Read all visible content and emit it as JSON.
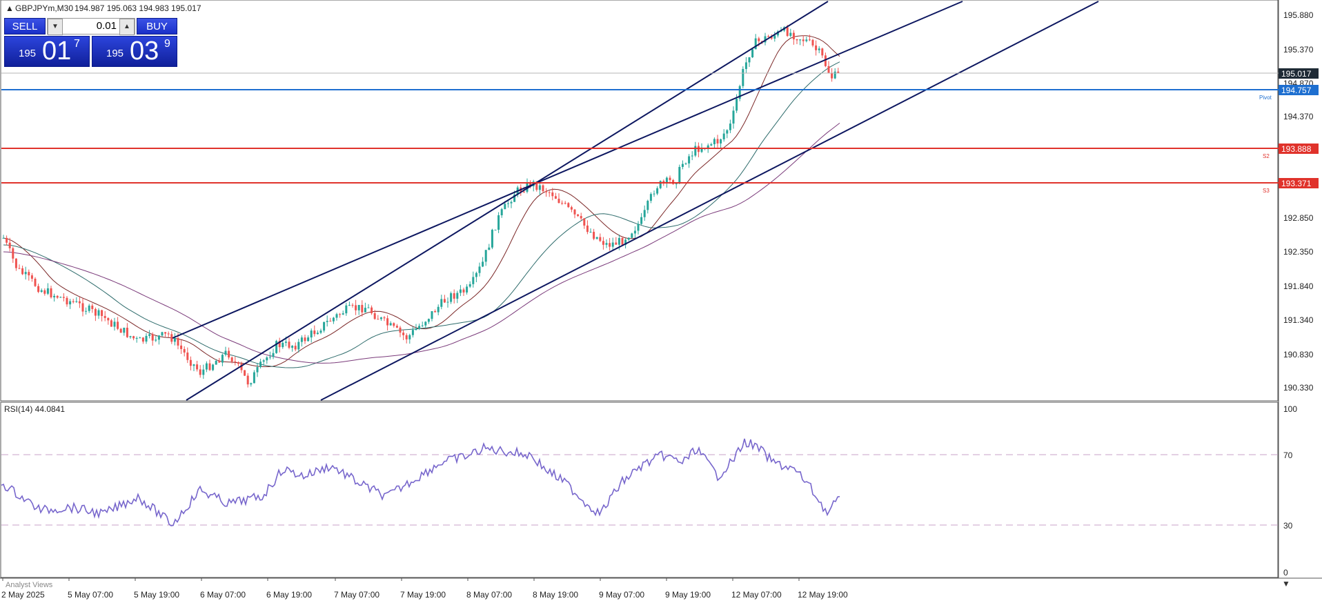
{
  "header": {
    "symbol_info": "GBPJPYm,M30",
    "ohlc": "194.987 195.063 194.983 195.017"
  },
  "trade_panel": {
    "sell_label": "SELL",
    "buy_label": "BUY",
    "lot_size": "0.01",
    "sell_price": {
      "prefix": "195",
      "big": "01",
      "sup": "7"
    },
    "buy_price": {
      "prefix": "195",
      "big": "03",
      "sup": "9"
    }
  },
  "price_axis": {
    "labels": [
      "195.880",
      "195.370",
      "194.870",
      "194.370",
      "192.850",
      "192.350",
      "191.840",
      "191.340",
      "190.830",
      "190.330"
    ],
    "current_price": "195.017",
    "current_price_color": "#1e2a35",
    "pivot_price": "194.757",
    "pivot_color": "#1e6fd0",
    "s2_price": "193.888",
    "s3_price": "193.371",
    "support_color": "#e0322b"
  },
  "level_tags": {
    "pivot": "Pivot",
    "s2": "S2",
    "s3": "S3"
  },
  "indicator": {
    "title": "RSI(14) 44.0841",
    "levels": [
      "100",
      "70",
      "30",
      "0"
    ],
    "line_color": "#7766cc"
  },
  "time_axis": {
    "labels": [
      "2 May 2025",
      "5 May 07:00",
      "5 May 19:00",
      "6 May 07:00",
      "6 May 19:00",
      "7 May 07:00",
      "7 May 19:00",
      "8 May 07:00",
      "8 May 19:00",
      "9 May 07:00",
      "9 May 19:00",
      "12 May 07:00",
      "12 May 19:00"
    ]
  },
  "footer": {
    "tab_label": "Analyst Views"
  },
  "colors": {
    "bull_candle": "#26a69a",
    "bear_candle": "#ef5350",
    "channel": "#0d1760",
    "ma_dark": "#7a2525",
    "ma_teal": "#2d6b6b",
    "ma_purple": "#7a3a7a"
  }
}
